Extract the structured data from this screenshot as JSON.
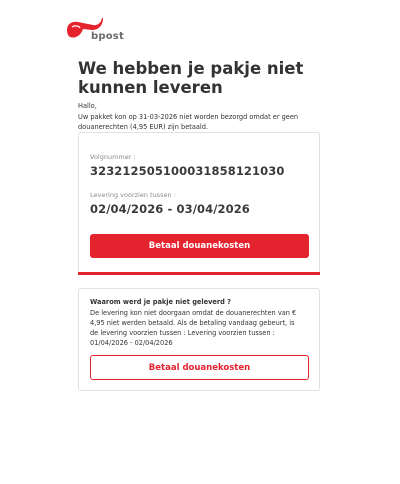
{
  "brand": {
    "name": "bpost",
    "color": "#e5232f"
  },
  "headline": "We hebben je pakje niet kunnen leveren",
  "intro": {
    "greeting": "Hallo,",
    "message": "Uw pakket kon op 31-03-2026 niet worden bezorgd omdat er geen douanerechten (4,95 EUR) zijn betaald."
  },
  "tracking": {
    "number_label": "Volgnummer :",
    "number_value": "323212505100031858121030",
    "delivery_label": "Levering voorzien tussen :",
    "delivery_value": "02/04/2026 - 03/04/2026",
    "button_label": "Betaal douanekosten"
  },
  "info": {
    "title": "Waarom werd je pakje niet geleverd ?",
    "text": "De levering kon niet doorgaan omdat de douanerechten van € 4,95 niet werden betaald. Als de betaling vandaag gebeurt, is de levering voorzien tussen : Levering voorzien tussen : 01/04/2026 - 02/04/2026",
    "button_label": "Betaal douanekosten"
  }
}
